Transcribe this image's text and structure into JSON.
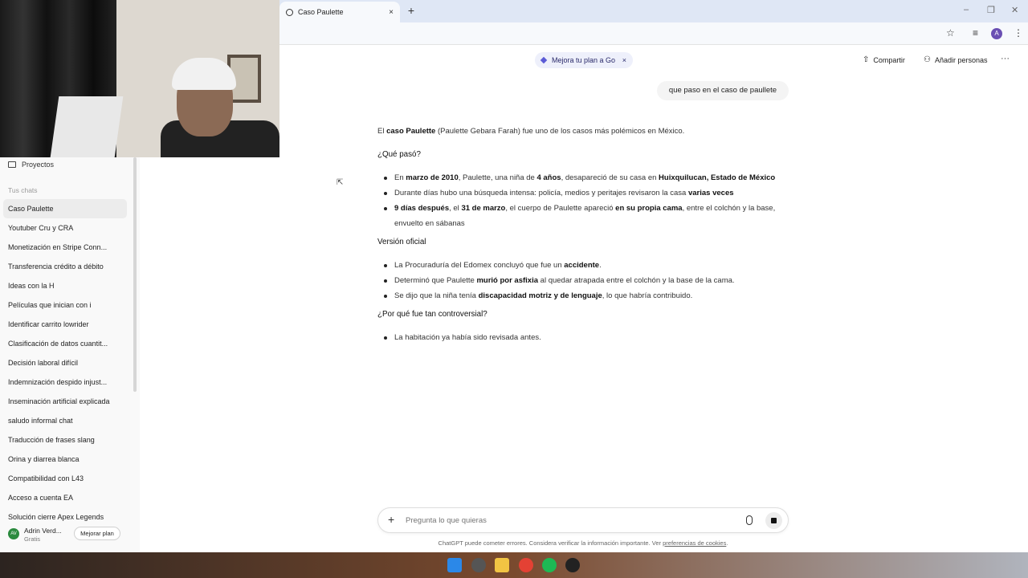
{
  "browser": {
    "tab_title": "Caso Paulette",
    "tab_close": "×",
    "new_tab": "+",
    "window_controls": [
      "–",
      "❐",
      "✕"
    ],
    "address_icons": [
      "star-icon",
      "tab-search-icon"
    ],
    "profile_initial": "A",
    "menu": "⋮"
  },
  "sidebar": {
    "projects_label": "Proyectos",
    "chats_label": "Tus chats",
    "chats": [
      "Caso Paulette",
      "Youtuber Cru y CRA",
      "Monetización en Stripe Conn...",
      "Transferencia crédito a débito",
      "Ideas con la H",
      "Películas que inician con i",
      "Identificar carrito lowrider",
      "Clasificación de datos cuantit...",
      "Decisión laboral difícil",
      "Indemnización despido injust...",
      "Inseminación artificial explicada",
      "saludo informal chat",
      "Traducción de frases slang",
      "Orina y diarrea blanca",
      "Compatibilidad con L43",
      "Acceso a cuenta EA",
      "Solución cierre Apex Legends"
    ],
    "user": {
      "initials": "AV",
      "name": "Adrin Verd...",
      "plan": "Gratis",
      "upgrade_label": "Mejorar plan"
    }
  },
  "header": {
    "promo_label": "Mejora tu plan a Go",
    "promo_close": "×",
    "share_label": "Compartir",
    "add_people_label": "Añadir personas",
    "more": "···"
  },
  "conversation": {
    "user_message": "que paso en el caso de paullete",
    "intro": {
      "pre": "El ",
      "bold": "caso Paulette",
      "post": " (Paulette Gebara Farah) fue uno de los casos más polémicos en México."
    },
    "sections": [
      {
        "heading": "¿Qué pasó?",
        "items": [
          [
            {
              "t": "En "
            },
            {
              "b": "marzo de 2010"
            },
            {
              "t": ", Paulette, una niña de "
            },
            {
              "b": "4 años"
            },
            {
              "t": ", desapareció de su casa en "
            },
            {
              "b": "Huixquilucan, Estado de México"
            }
          ],
          [
            {
              "t": "Durante días hubo una búsqueda intensa: policía, medios y peritajes revisaron la casa "
            },
            {
              "b": "varias veces"
            }
          ],
          [
            {
              "b": "9 días después"
            },
            {
              "t": ", el "
            },
            {
              "b": "31 de marzo"
            },
            {
              "t": ", el cuerpo de Paulette apareció "
            },
            {
              "b": "en su propia cama"
            },
            {
              "t": ", entre el colchón y la base, envuelto en sábanas"
            }
          ]
        ]
      },
      {
        "heading": "Versión oficial",
        "items": [
          [
            {
              "t": "La Procuraduría del Edomex concluyó que fue un "
            },
            {
              "b": "accidente"
            },
            {
              "t": "."
            }
          ],
          [
            {
              "t": "Determinó que Paulette "
            },
            {
              "b": "murió por asfixia"
            },
            {
              "t": " al quedar atrapada entre el colchón y la base de la cama."
            }
          ],
          [
            {
              "t": "Se dijo que la niña tenía "
            },
            {
              "b": "discapacidad motriz y de lenguaje"
            },
            {
              "t": ", lo que habría contribuido."
            }
          ]
        ]
      },
      {
        "heading": "¿Por qué fue tan controversial?",
        "items": [
          [
            {
              "t": "La habitación ya había sido revisada antes."
            }
          ]
        ]
      }
    ]
  },
  "composer": {
    "placeholder": "Pregunta lo que quieras",
    "plus": "+"
  },
  "footer": {
    "disclaimer_pre": "ChatGPT puede cometer errores. Considera verificar la información importante. Ver ",
    "disclaimer_link": "preferencias de cookies",
    "disclaimer_post": "."
  },
  "taskbar": {
    "apps": [
      "windows-start-icon",
      "search-icon",
      "file-explorer-icon",
      "chrome-icon",
      "spotify-icon",
      "app-icon"
    ],
    "colors": {
      "start": "#2b88e8",
      "search": "#555555",
      "explorer": "#f2c443",
      "chrome": "#e44134",
      "spotify": "#1db954",
      "app": "#222222"
    }
  },
  "colors": {
    "tabbar": "#dfe7f5",
    "sidebar": "#f9f9f9",
    "promo": "#eef0fb",
    "accent": "#5b5bd6"
  }
}
